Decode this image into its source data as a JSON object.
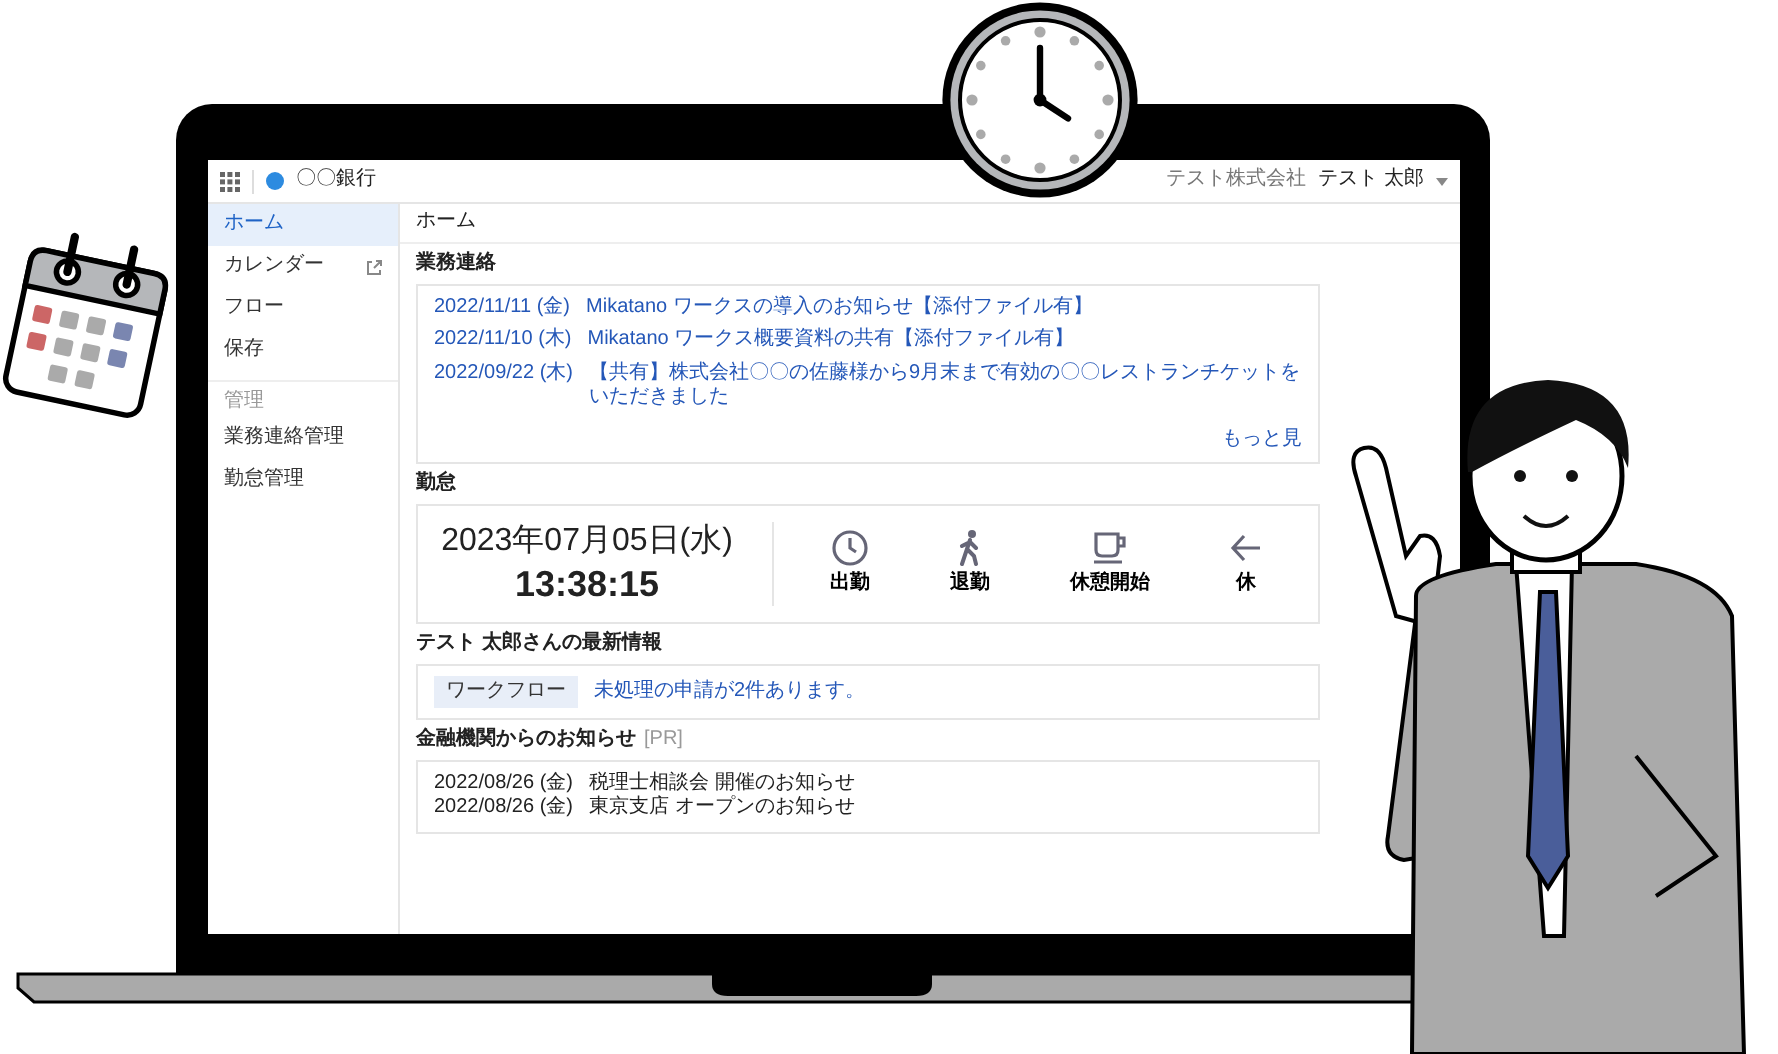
{
  "header": {
    "bank_name": "〇〇銀行",
    "company": "テスト株式会社",
    "user": "テスト 太郎"
  },
  "sidebar": {
    "items": [
      {
        "label": "ホーム",
        "selected": true,
        "external": false
      },
      {
        "label": "カレンダー",
        "selected": false,
        "external": true
      },
      {
        "label": "フロー",
        "selected": false,
        "external": false
      },
      {
        "label": "保存",
        "selected": false,
        "external": false
      }
    ],
    "section": "管理",
    "admin_items": [
      {
        "label": "業務連絡管理",
        "selected": false
      },
      {
        "label": "勤怠管理",
        "selected": false
      }
    ]
  },
  "breadcrumb": "ホーム",
  "notices": {
    "title": "業務連絡",
    "items": [
      {
        "date": "2022/11/11 (金)",
        "text": "Mikatano ワークスの導入のお知らせ【添付ファイル有】"
      },
      {
        "date": "2022/11/10 (木)",
        "text": "Mikatano ワークス概要資料の共有【添付ファイル有】"
      },
      {
        "date": "2022/09/22 (木)",
        "text": "【共有】株式会社〇〇の佐藤様から9月末まで有効の〇〇レストランチケットをいただきました"
      }
    ],
    "more": "もっと見"
  },
  "attendance": {
    "title": "勤怠",
    "date": "2023年07月05日(水)",
    "time": "13:38:15",
    "actions": [
      {
        "kind": "clock_in",
        "label": "出勤"
      },
      {
        "kind": "clock_out",
        "label": "退勤"
      },
      {
        "kind": "break_start",
        "label": "休憩開始"
      },
      {
        "kind": "break_end",
        "label": "休"
      }
    ]
  },
  "latest": {
    "title": "テスト 太郎さんの最新情報",
    "tag": "ワークフロー",
    "message": "未処理の申請が2件あります。"
  },
  "bank_notices": {
    "title": "金融機関からのお知らせ",
    "pr": "[PR]",
    "items": [
      {
        "date": "2022/08/26 (金)",
        "text": "税理士相談会 開催のお知らせ"
      },
      {
        "date": "2022/08/26 (金)",
        "text": "東京支店 オープンのお知らせ"
      }
    ]
  }
}
